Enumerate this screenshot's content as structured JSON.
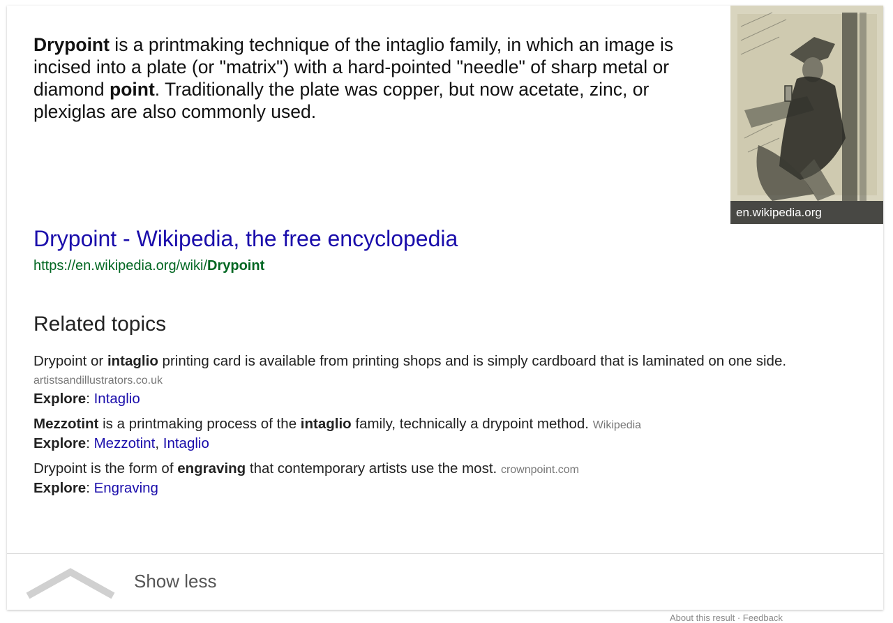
{
  "snippet": {
    "term_bold": "Drypoint",
    "text_1": " is a printmaking technique of the intaglio family, in which an image is incised into a plate (or \"matrix\") with a hard-pointed \"needle\" of sharp metal or diamond ",
    "point_bold": "point",
    "text_2": ". Traditionally the plate was copper, but now acetate, zinc, or plexiglas are also commonly used."
  },
  "image": {
    "caption": "en.wikipedia.org",
    "icon": "drypoint-artwork-thumbnail"
  },
  "result": {
    "title": "Drypoint - Wikipedia, the free encyclopedia",
    "url_prefix": "https://en.wikipedia.org/wiki/",
    "url_bold": "Drypoint"
  },
  "related": {
    "heading": "Related topics",
    "explore_label": "Explore",
    "items": [
      {
        "text_a": "Drypoint or ",
        "bold_a": "intaglio",
        "text_b": " printing card is available from printing shops and is simply cardboard that is laminated on one side.",
        "source": "artistsandillustrators.co.uk",
        "links": [
          "Intaglio"
        ]
      },
      {
        "bold_lead": "Mezzotint",
        "text_a": " is a printmaking process of the ",
        "bold_a": "intaglio",
        "text_b": " family, technically a drypoint method.",
        "source": "Wikipedia",
        "links": [
          "Mezzotint",
          "Intaglio"
        ]
      },
      {
        "text_a": "Drypoint is the form of ",
        "bold_a": "engraving",
        "text_b": " that contemporary artists use the most.",
        "source": "crownpoint.com",
        "links": [
          "Engraving"
        ]
      }
    ]
  },
  "footer": {
    "show_less_label": "Show less",
    "chevron_icon": "chevron-up-icon",
    "feedback_text": "About this result · Feedback"
  },
  "colors": {
    "link": "#1a0dab",
    "url": "#006621",
    "source": "#777777"
  }
}
